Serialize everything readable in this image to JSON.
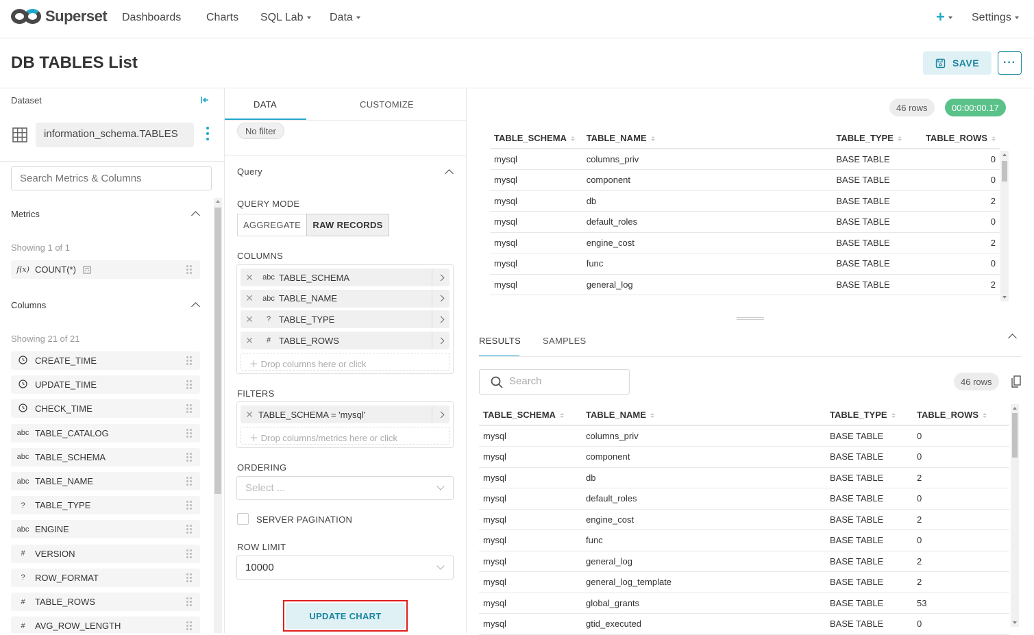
{
  "nav": {
    "brand": "Superset",
    "items": [
      "Dashboards",
      "Charts",
      "SQL Lab",
      "Data"
    ],
    "plus": "+",
    "settings": "Settings"
  },
  "header": {
    "title": "DB TABLES List",
    "save_label": "SAVE",
    "more_label": "···"
  },
  "dataset": {
    "label": "Dataset",
    "name": "information_schema.TABLES",
    "search_placeholder": "Search Metrics & Columns",
    "metrics_label": "Metrics",
    "metrics_showing": "Showing 1 of 1",
    "metrics": [
      {
        "type": "f(x)",
        "name": "COUNT(*)"
      }
    ],
    "columns_label": "Columns",
    "columns_showing": "Showing 21 of 21",
    "columns": [
      {
        "type": "clock",
        "name": "CREATE_TIME"
      },
      {
        "type": "clock",
        "name": "UPDATE_TIME"
      },
      {
        "type": "clock",
        "name": "CHECK_TIME"
      },
      {
        "type": "abc",
        "name": "TABLE_CATALOG"
      },
      {
        "type": "abc",
        "name": "TABLE_SCHEMA"
      },
      {
        "type": "abc",
        "name": "TABLE_NAME"
      },
      {
        "type": "?",
        "name": "TABLE_TYPE"
      },
      {
        "type": "abc",
        "name": "ENGINE"
      },
      {
        "type": "#",
        "name": "VERSION"
      },
      {
        "type": "?",
        "name": "ROW_FORMAT"
      },
      {
        "type": "#",
        "name": "TABLE_ROWS"
      },
      {
        "type": "#",
        "name": "AVG_ROW_LENGTH"
      }
    ]
  },
  "control": {
    "tabs": [
      "DATA",
      "CUSTOMIZE"
    ],
    "no_filter": "No filter",
    "query_label": "Query",
    "query_mode_label": "QUERY MODE",
    "query_modes": [
      "AGGREGATE",
      "RAW RECORDS"
    ],
    "columns_label": "COLUMNS",
    "columns": [
      {
        "type": "abc",
        "name": "TABLE_SCHEMA"
      },
      {
        "type": "abc",
        "name": "TABLE_NAME"
      },
      {
        "type": "?",
        "name": "TABLE_TYPE"
      },
      {
        "type": "#",
        "name": "TABLE_ROWS"
      }
    ],
    "columns_drop": "Drop columns here or click",
    "filters_label": "FILTERS",
    "filter": "TABLE_SCHEMA = 'mysql'",
    "filters_drop": "Drop columns/metrics here or click",
    "ordering_label": "ORDERING",
    "ordering_placeholder": "Select ...",
    "server_pagination": "SERVER PAGINATION",
    "row_limit_label": "ROW LIMIT",
    "row_limit": "10000",
    "update_label": "UPDATE CHART"
  },
  "chart": {
    "rows": "46 rows",
    "time": "00:00:00.17",
    "headers": [
      "TABLE_SCHEMA",
      "TABLE_NAME",
      "TABLE_TYPE",
      "TABLE_ROWS"
    ],
    "data": [
      [
        "mysql",
        "columns_priv",
        "BASE TABLE",
        "0"
      ],
      [
        "mysql",
        "component",
        "BASE TABLE",
        "0"
      ],
      [
        "mysql",
        "db",
        "BASE TABLE",
        "2"
      ],
      [
        "mysql",
        "default_roles",
        "BASE TABLE",
        "0"
      ],
      [
        "mysql",
        "engine_cost",
        "BASE TABLE",
        "2"
      ],
      [
        "mysql",
        "func",
        "BASE TABLE",
        "0"
      ],
      [
        "mysql",
        "general_log",
        "BASE TABLE",
        "2"
      ]
    ]
  },
  "results": {
    "tabs": [
      "RESULTS",
      "SAMPLES"
    ],
    "search_placeholder": "Search",
    "rows": "46 rows",
    "headers": [
      "TABLE_SCHEMA",
      "TABLE_NAME",
      "TABLE_TYPE",
      "TABLE_ROWS"
    ],
    "data": [
      [
        "mysql",
        "columns_priv",
        "BASE TABLE",
        "0"
      ],
      [
        "mysql",
        "component",
        "BASE TABLE",
        "0"
      ],
      [
        "mysql",
        "db",
        "BASE TABLE",
        "2"
      ],
      [
        "mysql",
        "default_roles",
        "BASE TABLE",
        "0"
      ],
      [
        "mysql",
        "engine_cost",
        "BASE TABLE",
        "2"
      ],
      [
        "mysql",
        "func",
        "BASE TABLE",
        "0"
      ],
      [
        "mysql",
        "general_log",
        "BASE TABLE",
        "2"
      ],
      [
        "mysql",
        "general_log_template",
        "BASE TABLE",
        "2"
      ],
      [
        "mysql",
        "global_grants",
        "BASE TABLE",
        "53"
      ],
      [
        "mysql",
        "gtid_executed",
        "BASE TABLE",
        "0"
      ]
    ]
  },
  "colors": {
    "accent": "#20a7c9",
    "accent_dark": "#1985a0",
    "success": "#5ac189",
    "highlight": "#e11d1d"
  }
}
